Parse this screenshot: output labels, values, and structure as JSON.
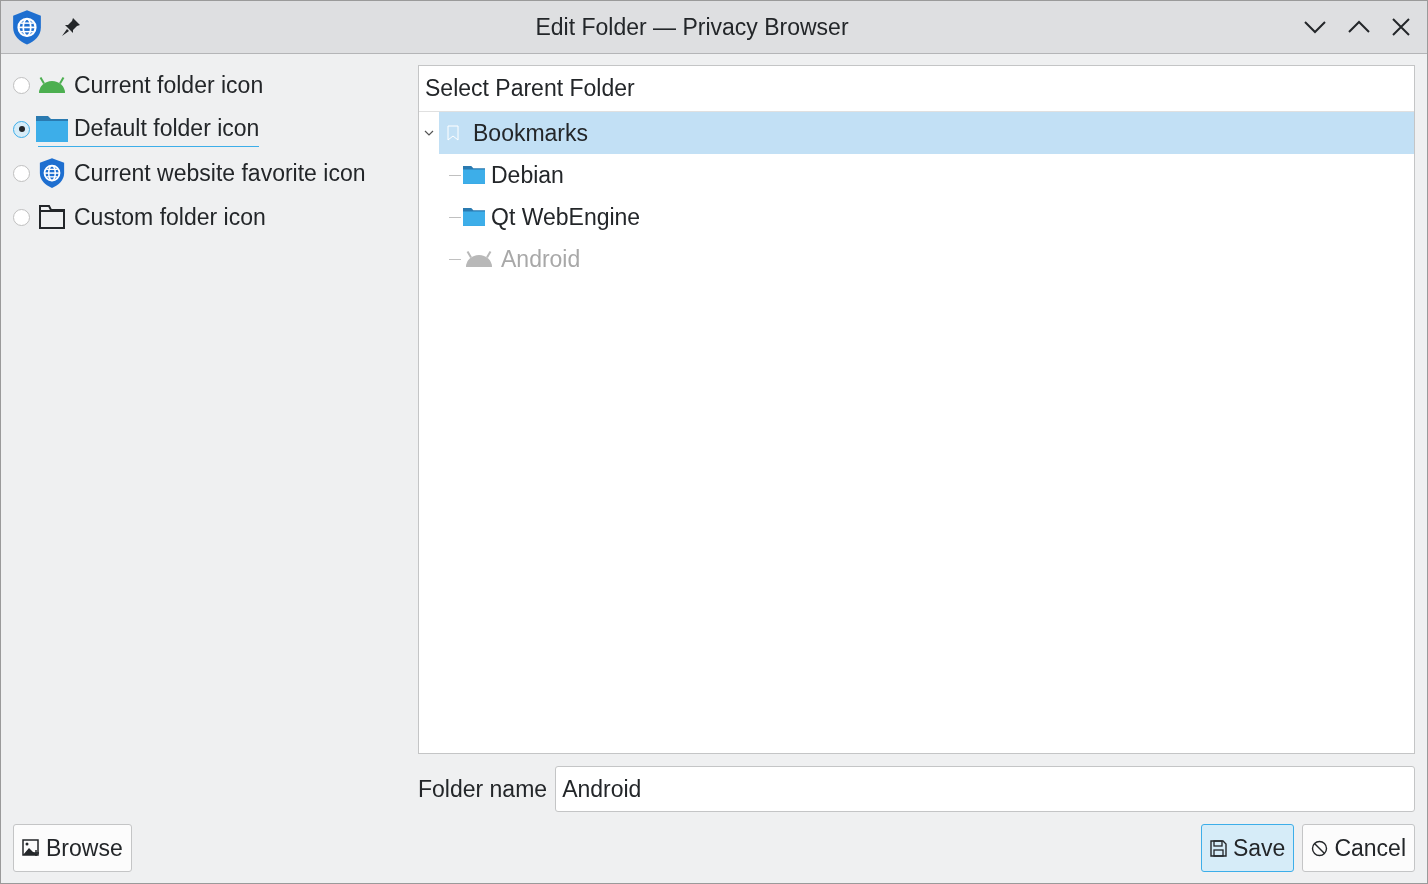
{
  "window": {
    "title": "Edit Folder — Privacy Browser"
  },
  "icon_options": [
    {
      "kind": "android",
      "label": "Current folder icon",
      "selected": false,
      "focused": false
    },
    {
      "kind": "folder",
      "label": "Default folder icon",
      "selected": true,
      "focused": true
    },
    {
      "kind": "globe",
      "label": "Current website favorite icon",
      "selected": false,
      "focused": false
    },
    {
      "kind": "custom",
      "label": "Custom folder icon",
      "selected": false,
      "focused": false
    }
  ],
  "tree": {
    "header": "Select Parent Folder",
    "items": [
      {
        "kind": "bookmark",
        "label": "Bookmarks",
        "selected": true,
        "expanded": true,
        "disabled": false,
        "children": [
          {
            "kind": "folder",
            "label": "Debian",
            "selected": false,
            "disabled": false
          },
          {
            "kind": "folder",
            "label": "Qt WebEngine",
            "selected": false,
            "disabled": false
          },
          {
            "kind": "android",
            "label": "Android",
            "selected": false,
            "disabled": true
          }
        ]
      }
    ]
  },
  "folder_name": {
    "label": "Folder name",
    "value": "Android"
  },
  "buttons": [
    {
      "kind": "browse",
      "label": "Browse",
      "default": false
    },
    {
      "kind": "save",
      "label": "Save",
      "default": true
    },
    {
      "kind": "cancel",
      "label": "Cancel",
      "default": false
    }
  ]
}
